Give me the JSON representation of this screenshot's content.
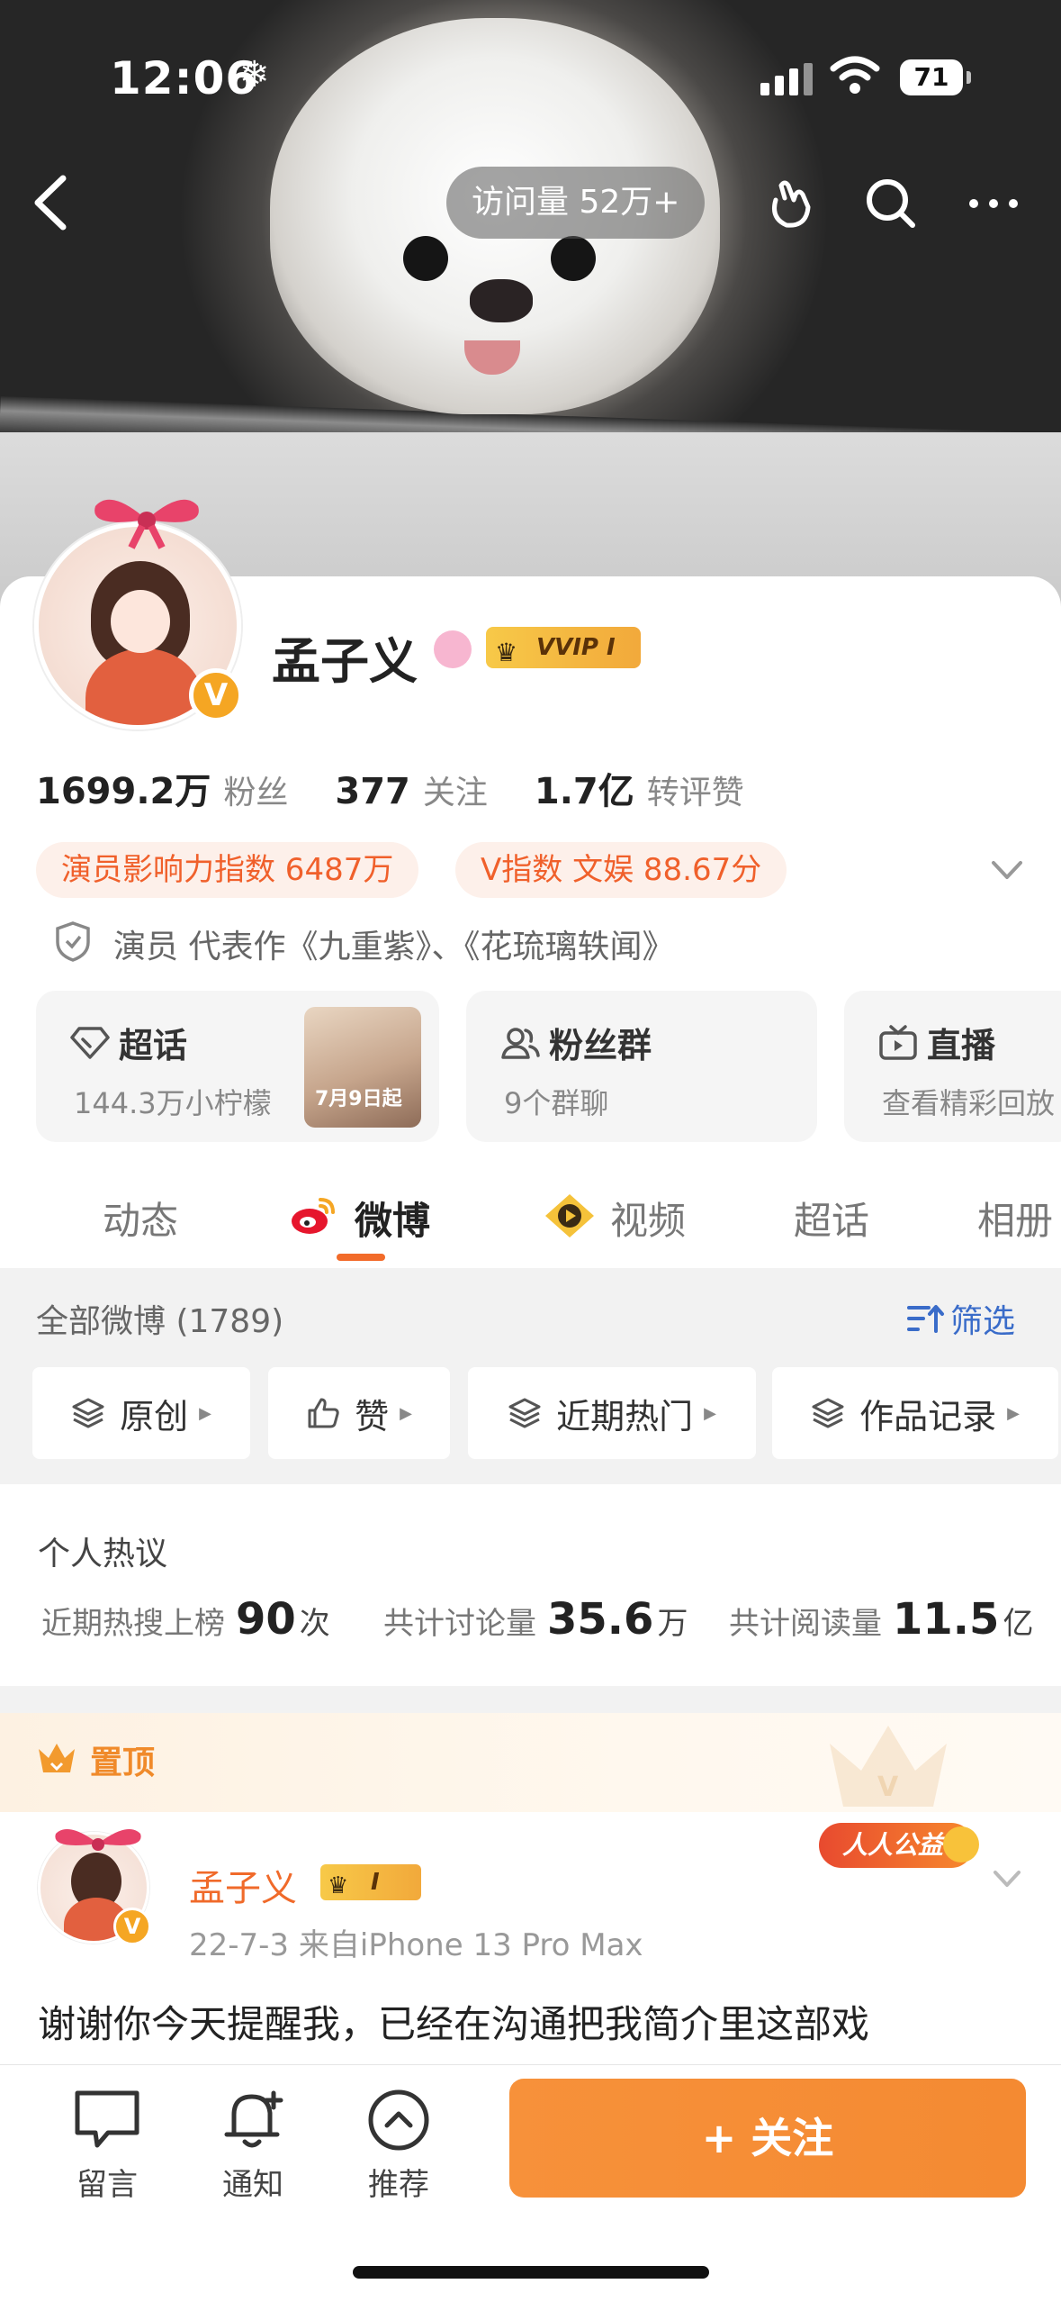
{
  "status_bar": {
    "time": "12:06",
    "extra_icon": "snowflake-icon",
    "battery": "71"
  },
  "header": {
    "visits": "访问量 52万+"
  },
  "profile": {
    "name": "孟子义",
    "vip_badge": "VVIP I",
    "verified_badge": "V",
    "stats": [
      {
        "value": "1699.2万",
        "label": "粉丝"
      },
      {
        "value": "377",
        "label": "关注"
      },
      {
        "value": "1.7亿",
        "label": "转评赞"
      }
    ],
    "tags": [
      "演员影响力指数 6487万",
      "V指数 文娱 88.67分"
    ],
    "bio": "演员 代表作《九重紫》、《花琉璃轶闻》",
    "entries": [
      {
        "title": "超话",
        "subtitle": "144.3万小柠檬",
        "thumb_text": "7月9日起"
      },
      {
        "title": "粉丝群",
        "subtitle": "9个群聊"
      },
      {
        "title": "直播",
        "subtitle": "查看精彩回放"
      }
    ]
  },
  "tabs": [
    "动态",
    "微博",
    "视频",
    "超话",
    "相册"
  ],
  "active_tab": "微博",
  "feed": {
    "all_count": "全部微博 (1789)",
    "filter_label": "筛选",
    "chips": [
      "原创",
      "赞",
      "近期热门",
      "作品记录"
    ]
  },
  "hot": {
    "title": "个人热议",
    "items": [
      {
        "label": "近期热搜上榜",
        "value": "90",
        "unit": "次"
      },
      {
        "label": "共计讨论量",
        "value": "35.6",
        "unit": "万"
      },
      {
        "label": "共计阅读量",
        "value": "11.5",
        "unit": "亿"
      }
    ]
  },
  "pinned": {
    "label": "置顶",
    "charity": "人人公益",
    "author": "孟子义",
    "vip_badge": "I",
    "verified_badge": "V",
    "meta": "22-7-3  来自iPhone 13 Pro Max",
    "text": "谢谢你今天提醒我，已经在沟通把我简介里这部戏"
  },
  "bottom_bar": {
    "items": [
      {
        "label": "留言",
        "icon": "message-icon"
      },
      {
        "label": "通知",
        "icon": "bell-plus-icon"
      },
      {
        "label": "推荐",
        "icon": "chevron-up-circle-icon"
      }
    ],
    "follow_label": "+ 关注"
  },
  "colors": {
    "accent": "#F26B2A",
    "follow_button": "#F48A32",
    "link_blue": "#3A6CC9",
    "tag_bg": "#FDF0EA"
  }
}
